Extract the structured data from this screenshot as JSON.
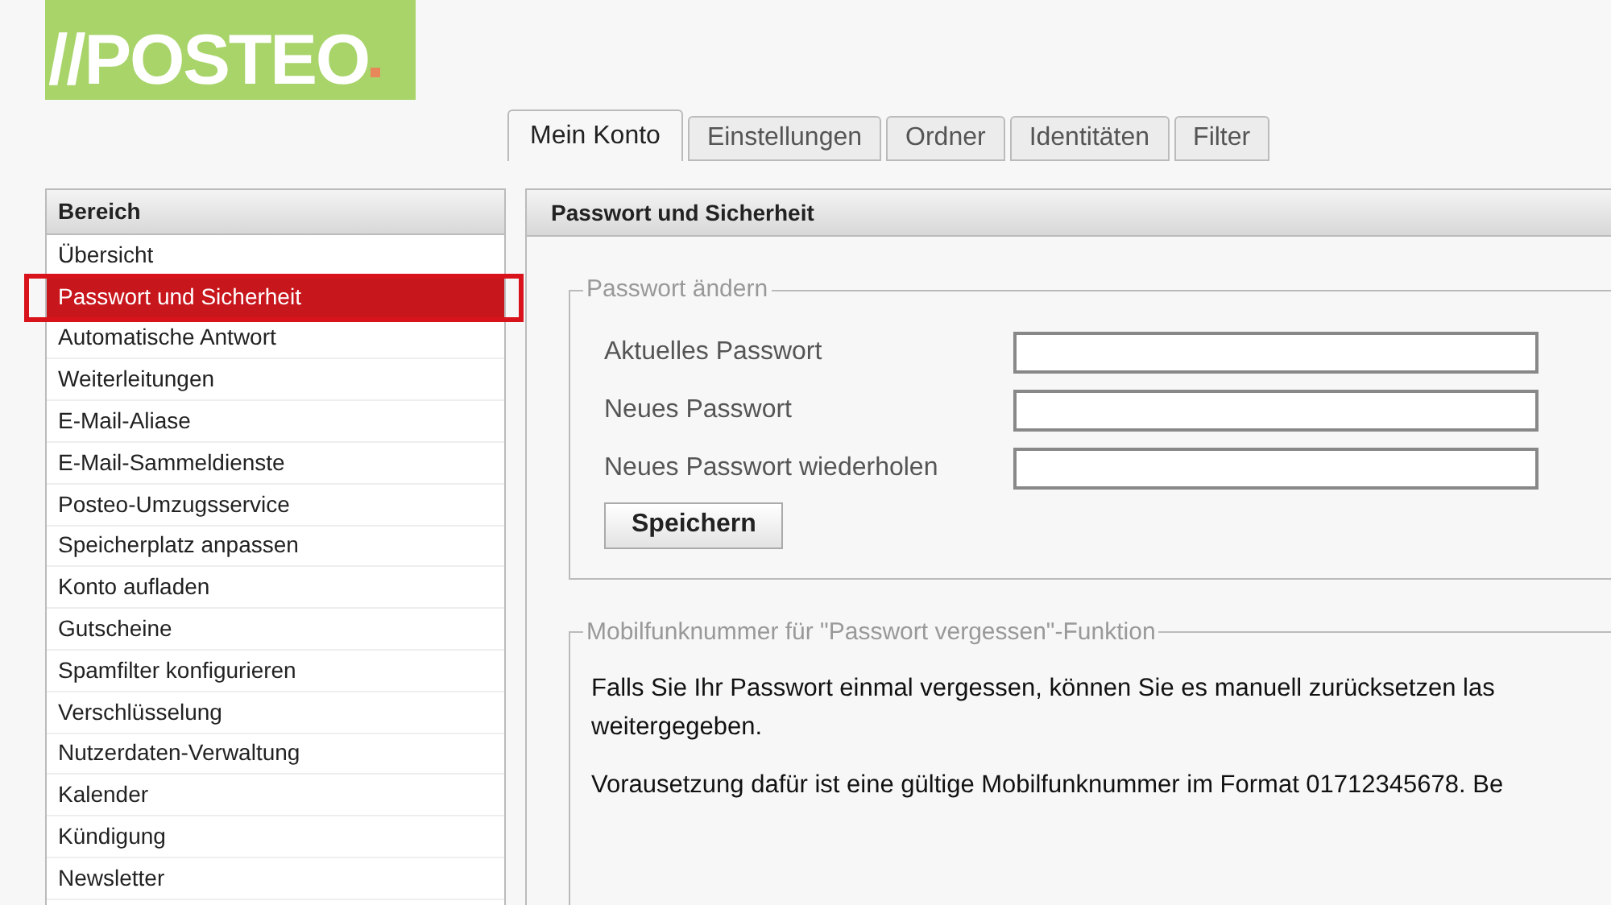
{
  "logo": {
    "text": "//POSTEO"
  },
  "tabs": [
    {
      "label": "Mein Konto",
      "selected": true
    },
    {
      "label": "Einstellungen",
      "selected": false
    },
    {
      "label": "Ordner",
      "selected": false
    },
    {
      "label": "Identitäten",
      "selected": false
    },
    {
      "label": "Filter",
      "selected": false
    }
  ],
  "sidebar": {
    "header": "Bereich",
    "items": [
      {
        "label": "Übersicht",
        "selected": false
      },
      {
        "label": "Passwort und Sicherheit",
        "selected": true
      },
      {
        "label": "Automatische Antwort",
        "selected": false
      },
      {
        "label": "Weiterleitungen",
        "selected": false
      },
      {
        "label": "E-Mail-Aliase",
        "selected": false
      },
      {
        "label": "E-Mail-Sammeldienste",
        "selected": false
      },
      {
        "label": "Posteo-Umzugsservice",
        "selected": false
      },
      {
        "label": "Speicherplatz anpassen",
        "selected": false
      },
      {
        "label": "Konto aufladen",
        "selected": false
      },
      {
        "label": "Gutscheine",
        "selected": false
      },
      {
        "label": "Spamfilter konfigurieren",
        "selected": false
      },
      {
        "label": "Verschlüsselung",
        "selected": false
      },
      {
        "label": "Nutzerdaten-Verwaltung",
        "selected": false
      },
      {
        "label": "Kalender",
        "selected": false
      },
      {
        "label": "Kündigung",
        "selected": false
      },
      {
        "label": "Newsletter",
        "selected": false
      }
    ]
  },
  "panel": {
    "title": "Passwort und Sicherheit",
    "password_section": {
      "legend": "Passwort ändern",
      "fields": [
        {
          "label": "Aktuelles Passwort"
        },
        {
          "label": "Neues Passwort"
        },
        {
          "label": "Neues Passwort wiederholen"
        }
      ],
      "button": "Speichern"
    },
    "mobile_section": {
      "legend": "Mobilfunknummer für \"Passwort vergessen\"-Funktion",
      "paragraphs": [
        {
          "lines": [
            "Falls Sie Ihr Passwort einmal vergessen, können Sie es manuell zurücksetzen las",
            "weitergegeben."
          ]
        },
        {
          "lines": [
            "Vorausetzung dafür ist eine gültige Mobilfunknummer im Format 01712345678. Be"
          ]
        }
      ]
    }
  }
}
